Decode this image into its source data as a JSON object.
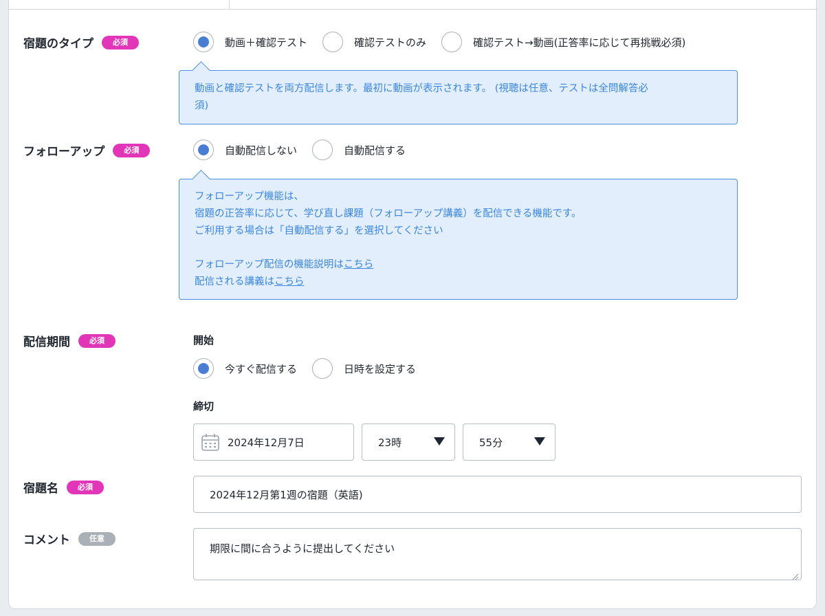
{
  "homework_type": {
    "label": "宿題のタイプ",
    "badge": "必須",
    "options": [
      {
        "label": "動画＋確認テスト",
        "selected": true
      },
      {
        "label": "確認テストのみ",
        "selected": false
      },
      {
        "label": "確認テスト→動画(正答率に応じて再挑戦必須)",
        "selected": false
      }
    ],
    "info_line1": "動画と確認テストを両方配信します。最初に動画が表示されます。 (視聴は任意、テストは全問解答必",
    "info_line2": "須)"
  },
  "follow_up": {
    "label": "フォローアップ",
    "badge": "必須",
    "options": [
      {
        "label": "自動配信しない",
        "selected": true
      },
      {
        "label": "自動配信する",
        "selected": false
      }
    ],
    "info_line1": "フォローアップ機能は、",
    "info_line2": "宿題の正答率に応じて、学び直し課題（フォローアップ講義）を配信できる機能です。",
    "info_line3": "ご利用する場合は「自動配信する」を選択してください",
    "info_line4_prefix": "フォローアップ配信の機能説明は",
    "info_line4_link": "こちら",
    "info_line5_prefix": "配信される講義は",
    "info_line5_link": "こちら"
  },
  "delivery_period": {
    "label": "配信期間",
    "badge": "必須",
    "start_label": "開始",
    "start_options": [
      {
        "label": "今すぐ配信する",
        "selected": true
      },
      {
        "label": "日時を設定する",
        "selected": false
      }
    ],
    "deadline_label": "締切",
    "deadline_date": "2024年12月7日",
    "deadline_hour": "23時",
    "deadline_minute": "55分"
  },
  "homework_name": {
    "label": "宿題名",
    "badge": "必須",
    "value": "2024年12月第1週の宿題（英語)"
  },
  "comment": {
    "label": "コメント",
    "badge": "任意",
    "value": "期限に間に合うように提出してください"
  },
  "colors": {
    "required_badge": "#e236b8",
    "optional_badge": "#a9b0b8",
    "radio_selected": "#4a7ed1",
    "info_bg": "#e3eefc",
    "info_border": "#4a90e2",
    "info_text": "#3a86e0"
  }
}
